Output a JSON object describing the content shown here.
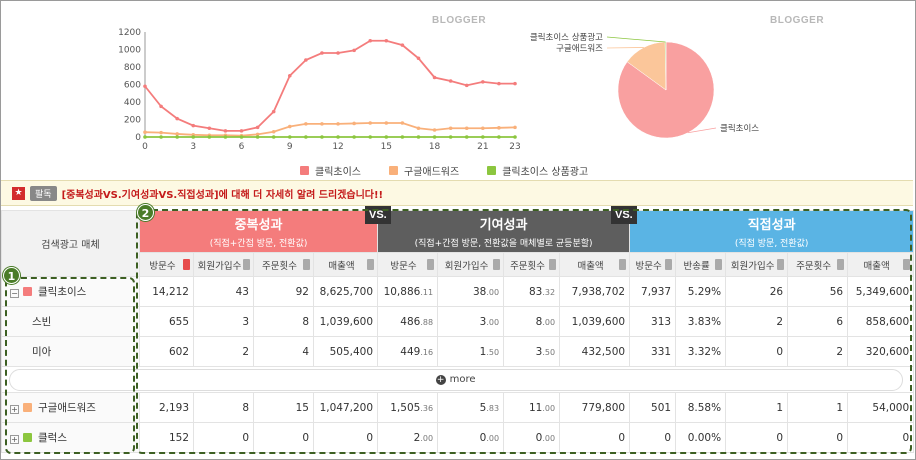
{
  "line_chart": {
    "type": "line",
    "x": [
      0,
      1,
      2,
      3,
      4,
      5,
      6,
      7,
      8,
      9,
      10,
      11,
      12,
      13,
      14,
      15,
      16,
      17,
      18,
      19,
      20,
      21,
      22,
      23
    ],
    "xticks": [
      "0",
      "3",
      "6",
      "9",
      "12",
      "15",
      "18",
      "21",
      "23"
    ],
    "yticks": [
      "0",
      "200",
      "400",
      "600",
      "800",
      "1000",
      "1200"
    ],
    "ylim": [
      0,
      1200
    ],
    "series": [
      {
        "name": "클릭초이스",
        "color": "#f47c7c",
        "values": [
          580,
          350,
          210,
          130,
          100,
          70,
          70,
          110,
          290,
          700,
          880,
          960,
          960,
          990,
          1100,
          1100,
          1050,
          900,
          680,
          640,
          590,
          630,
          610,
          610
        ]
      },
      {
        "name": "구글애드워즈",
        "color": "#f9b07a",
        "values": [
          55,
          50,
          35,
          25,
          20,
          20,
          15,
          30,
          60,
          120,
          150,
          150,
          150,
          155,
          160,
          160,
          160,
          100,
          80,
          100,
          100,
          100,
          105,
          110
        ]
      },
      {
        "name": "클릭초이스 상품광고",
        "color": "#8cc63f",
        "values": [
          0,
          0,
          0,
          0,
          0,
          0,
          0,
          0,
          0,
          0,
          0,
          0,
          0,
          0,
          0,
          0,
          0,
          0,
          0,
          0,
          0,
          0,
          0,
          0
        ]
      }
    ]
  },
  "pie_chart": {
    "type": "pie",
    "slices": [
      {
        "label": "클릭초이스",
        "value": 85.0,
        "color": "#f9a0a0"
      },
      {
        "label": "구글애드워즈",
        "value": 14.7,
        "color": "#fbc69a"
      },
      {
        "label": "클릭초이스 상품광고",
        "value": 0.3,
        "color": "#8cc63f"
      }
    ]
  },
  "logo_text": "BLOGGER",
  "legend": {
    "a": "클릭초이스",
    "b": "구글애드워즈",
    "c": "클릭초이스 상품광고"
  },
  "notice": {
    "tag": "팔독",
    "text": "[중복성과VS.기여성과VS.직접성과]에 대해 더 자세히 알려 드리겠습니다!!"
  },
  "table": {
    "media_header": "검색광고 매체",
    "groups": [
      {
        "title": "중복성과",
        "sub": "(직접+간접 방문, 전환값)"
      },
      {
        "title": "기여성과",
        "sub": "(직접+간접 방문, 전환값을 매체별로 균등분할)"
      },
      {
        "title": "직접성과",
        "sub": "(직접 방문, 전환값)"
      }
    ],
    "vs_label": "VS.",
    "cols": [
      "방문수",
      "회원가입수",
      "주문횟수",
      "매출액",
      "방문수",
      "회원가입수",
      "주문횟수",
      "매출액",
      "방문수",
      "반송률",
      "회원가입수",
      "주문횟수",
      "매출액"
    ],
    "more_label": "more",
    "rows": [
      {
        "name": "클릭초이스",
        "pm": "−",
        "color": "#f47c7c",
        "v": [
          "14,212",
          "43",
          "92",
          "8,625,700",
          "10,886",
          "38",
          "83",
          "7,938,702",
          "7,937",
          "5.29%",
          "26",
          "56",
          "5,349,600"
        ],
        "d": [
          "",
          "",
          "",
          "",
          ".11",
          ".00",
          ".32",
          "",
          "",
          "",
          "",
          "",
          ""
        ]
      },
      {
        "name": "스빈",
        "pm": "",
        "color": "",
        "v": [
          "655",
          "3",
          "8",
          "1,039,600",
          "486",
          "3",
          "8",
          "1,039,600",
          "313",
          "3.83%",
          "2",
          "6",
          "858,600"
        ],
        "d": [
          "",
          "",
          "",
          "",
          ".88",
          ".00",
          ".00",
          "",
          "",
          "",
          "",
          "",
          ""
        ]
      },
      {
        "name": "미아",
        "pm": "",
        "color": "",
        "v": [
          "602",
          "2",
          "4",
          "505,400",
          "449",
          "1",
          "3",
          "432,500",
          "331",
          "3.32%",
          "0",
          "2",
          "320,600"
        ],
        "d": [
          "",
          "",
          "",
          "",
          ".16",
          ".50",
          ".50",
          "",
          "",
          "",
          "",
          "",
          ""
        ]
      },
      {
        "name": "구글애드워즈",
        "pm": "+",
        "color": "#f9b07a",
        "v": [
          "2,193",
          "8",
          "15",
          "1,047,200",
          "1,505",
          "5",
          "11",
          "779,800",
          "501",
          "8.58%",
          "1",
          "1",
          "54,000"
        ],
        "d": [
          "",
          "",
          "",
          "",
          ".36",
          ".83",
          ".00",
          "",
          "",
          "",
          "",
          "",
          ""
        ]
      },
      {
        "name": "클럭스",
        "pm": "+",
        "color": "#8cc63f",
        "v": [
          "152",
          "0",
          "0",
          "0",
          "2",
          "0",
          "0",
          "0",
          "0",
          "0.00%",
          "0",
          "0",
          "0"
        ],
        "d": [
          "",
          "",
          "",
          "",
          ".00",
          ".00",
          ".00",
          "",
          "",
          "",
          "",
          "",
          ""
        ]
      }
    ]
  },
  "markers": {
    "m1": "1",
    "m2": "2"
  }
}
